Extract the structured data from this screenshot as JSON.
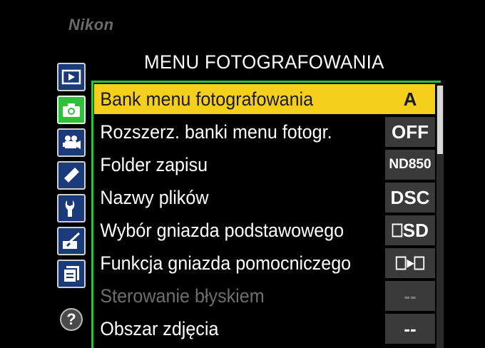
{
  "brand": "Nikon",
  "title": "MENU FOTOGRAFOWANIA",
  "sidebar": {
    "tabs": [
      {
        "name": "playback-menu",
        "icon": "playback-icon",
        "active": false
      },
      {
        "name": "photo-shooting-menu",
        "icon": "camera-icon",
        "active": true
      },
      {
        "name": "movie-shooting-menu",
        "icon": "movie-camera-icon",
        "active": false
      },
      {
        "name": "custom-settings-menu",
        "icon": "pencil-icon",
        "active": false
      },
      {
        "name": "setup-menu",
        "icon": "wrench-icon",
        "active": false
      },
      {
        "name": "retouch-menu",
        "icon": "retouch-brush-icon",
        "active": false
      },
      {
        "name": "my-menu",
        "icon": "recent-settings-icon",
        "active": false
      }
    ],
    "help_label": "?"
  },
  "menu": {
    "items": [
      {
        "label": "Bank menu fotografowania",
        "value": "A",
        "selected": true,
        "disabled": false
      },
      {
        "label": "Rozszerz. banki menu fotogr.",
        "value": "OFF",
        "selected": false,
        "disabled": false
      },
      {
        "label": "Folder zapisu",
        "value": "ND850",
        "selected": false,
        "disabled": false
      },
      {
        "label": "Nazwy plików",
        "value": "DSC",
        "selected": false,
        "disabled": false
      },
      {
        "label": "Wybór gniazda podstawowego",
        "value": "⎕SD",
        "selected": false,
        "disabled": false
      },
      {
        "label": "Funkcja gniazda pomocniczego",
        "value": "⎕▸⎕",
        "selected": false,
        "disabled": false
      },
      {
        "label": "Sterowanie błyskiem",
        "value": "--",
        "selected": false,
        "disabled": true
      },
      {
        "label": "Obszar zdjęcia",
        "value": "--",
        "selected": false,
        "disabled": false
      }
    ]
  },
  "colors": {
    "highlight": "#f5cf1c",
    "active_tab": "#2fbf3a",
    "tab": "#1a3a7a",
    "frame_green": "#29c23a"
  }
}
